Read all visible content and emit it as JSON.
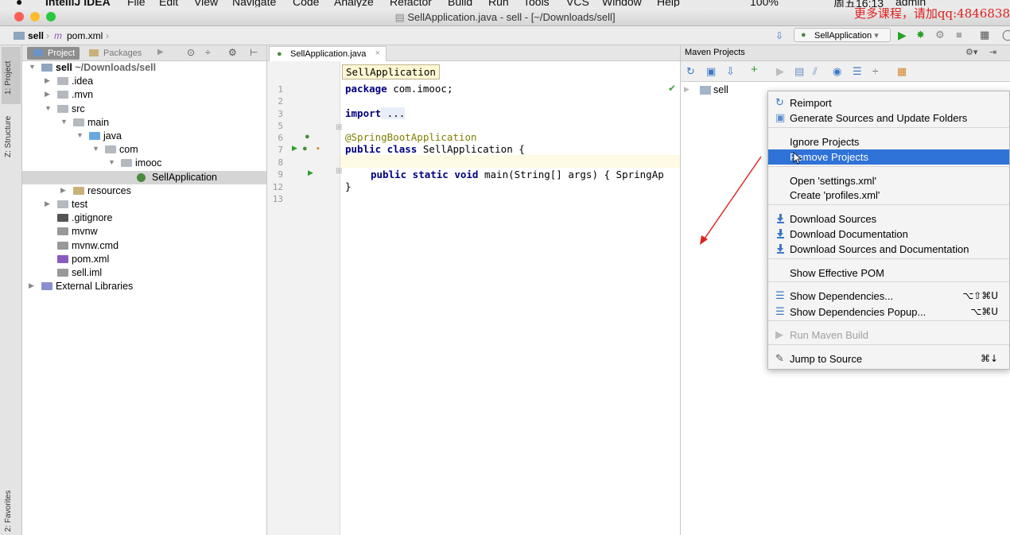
{
  "menubar": {
    "app": "IntelliJ IDEA",
    "menus": [
      "File",
      "Edit",
      "View",
      "Navigate",
      "Code",
      "Analyze",
      "Refactor",
      "Build",
      "Run",
      "Tools",
      "VCS",
      "Window",
      "Help"
    ],
    "battery": "100%",
    "clock": "周五16:13",
    "user": "admin"
  },
  "window": {
    "title": "SellApplication.java - sell - [~/Downloads/sell]"
  },
  "watermark": "更多课程，请加qq:4846838",
  "navbar": {
    "crumbs": [
      "sell",
      "pom.xml"
    ],
    "run_config": "SellApplication"
  },
  "side_tabs": {
    "project": "1: Project",
    "structure": "Z: Structure",
    "favorites": "2: Favorites"
  },
  "project_panel": {
    "tabs": [
      "Project",
      "Packages"
    ],
    "tree": [
      {
        "label": "sell",
        "suffix": " ~/Downloads/sell",
        "bold": true,
        "arrow": "▼"
      },
      {
        "label": ".idea",
        "arrow": "▶"
      },
      {
        "label": ".mvn",
        "arrow": "▶"
      },
      {
        "label": "src",
        "arrow": "▼"
      },
      {
        "label": "main",
        "arrow": "▼"
      },
      {
        "label": "java",
        "arrow": "▼"
      },
      {
        "label": "com",
        "arrow": "▼"
      },
      {
        "label": "imooc",
        "arrow": "▼"
      },
      {
        "label": "SellApplication",
        "arrow": "",
        "selected": true
      },
      {
        "label": "resources",
        "arrow": "▶"
      },
      {
        "label": "test",
        "arrow": "▶"
      },
      {
        "label": ".gitignore",
        "arrow": ""
      },
      {
        "label": "mvnw",
        "arrow": ""
      },
      {
        "label": "mvnw.cmd",
        "arrow": ""
      },
      {
        "label": "pom.xml",
        "arrow": ""
      },
      {
        "label": "sell.iml",
        "arrow": ""
      },
      {
        "label": "External Libraries",
        "arrow": "▶"
      }
    ]
  },
  "editor": {
    "tab": "SellApplication.java",
    "tooltip": "SellApplication",
    "line_numbers": [
      "1",
      "2",
      "3",
      "5",
      "6",
      "7",
      "8",
      "9",
      "12",
      "13"
    ],
    "code": {
      "l1_kw": "package",
      "l1_rest": " com.imooc;",
      "l3_kw": "import",
      "l3_rest": " ...",
      "l6": "@SpringBootApplication",
      "l7_kw": "public class",
      "l7_rest": " SellApplication {",
      "l9_kw": "public static void",
      "l9_rest": " main(String[] args) { SpringAp",
      "l12": "}"
    }
  },
  "maven": {
    "title": "Maven Projects",
    "root": "sell",
    "menu": [
      {
        "label": "Reimport",
        "icon": "reimport-icon"
      },
      {
        "label": "Generate Sources and Update Folders",
        "icon": "generate-sources-icon"
      },
      {
        "label": "Ignore Projects"
      },
      {
        "label": "Remove Projects",
        "highlighted": true
      },
      {
        "label": "Open 'settings.xml'"
      },
      {
        "label": "Create 'profiles.xml'"
      },
      {
        "label": "Download Sources",
        "icon": "download-icon"
      },
      {
        "label": "Download Documentation",
        "icon": "download-icon"
      },
      {
        "label": "Download Sources and Documentation",
        "icon": "download-icon"
      },
      {
        "label": "Show Effective POM"
      },
      {
        "label": "Show Dependencies...",
        "icon": "dependencies-icon",
        "shortcut": "⌥⇧⌘U"
      },
      {
        "label": "Show Dependencies Popup...",
        "icon": "dependencies-icon",
        "shortcut": "⌥⌘U"
      },
      {
        "label": "Run Maven Build",
        "icon": "run-icon",
        "disabled": true
      },
      {
        "label": "Jump to Source",
        "icon": "jump-icon",
        "shortcut": "⌘↓"
      }
    ]
  },
  "colors": {
    "accent": "#2f72d8",
    "annotation_arrow": "#e01f1f",
    "watermark": "#e02020"
  }
}
